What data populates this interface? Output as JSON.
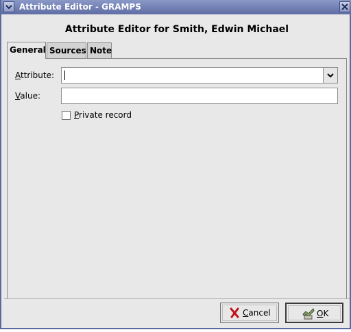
{
  "window": {
    "title": "Attribute Editor - GRAMPS"
  },
  "heading": "Attribute Editor for Smith, Edwin Michael",
  "tabs": [
    "General",
    "Sources",
    "Note"
  ],
  "form": {
    "attribute_label_u": "A",
    "attribute_label_rest": "ttribute:",
    "attribute_value": "",
    "value_label_u": "V",
    "value_label_rest": "alue:",
    "value_value": "",
    "private_label_u": "P",
    "private_label_rest": "rivate record"
  },
  "buttons": {
    "cancel_u": "C",
    "cancel_rest": "ancel",
    "ok_u": "O",
    "ok_rest": "K"
  },
  "icons": {
    "window_menu": "chevron-down-icon",
    "close": "close-icon",
    "combo_arrow": "chevron-down-icon",
    "cancel": "red-x-icon",
    "ok": "check-hand-icon"
  }
}
